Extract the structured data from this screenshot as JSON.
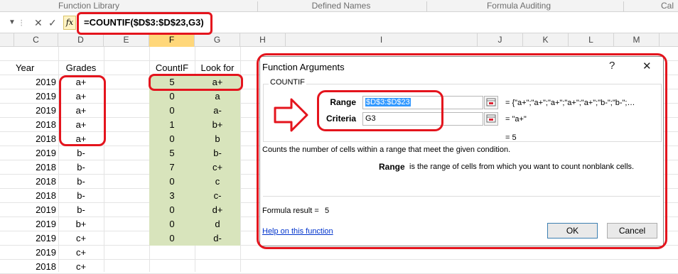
{
  "ribbon": {
    "groups": [
      "Function Library",
      "Defined Names",
      "Formula Auditing",
      "Cal"
    ]
  },
  "formula_bar": {
    "cancel_glyph": "✕",
    "enter_glyph": "✓",
    "fx_label": "fx",
    "formula": "=COUNTIF($D$3:$D$23,G3)"
  },
  "columns": [
    "C",
    "D",
    "E",
    "F",
    "G",
    "H",
    "I",
    "J",
    "K",
    "L",
    "M"
  ],
  "header_row": {
    "year": "Year",
    "grades": "Grades",
    "countif": "CountIF",
    "lookfor": "Look for"
  },
  "rows": [
    {
      "year": "2019",
      "grade": "a+",
      "count": "5",
      "look": "a+"
    },
    {
      "year": "2019",
      "grade": "a+",
      "count": "0",
      "look": "a"
    },
    {
      "year": "2019",
      "grade": "a+",
      "count": "0",
      "look": "a-"
    },
    {
      "year": "2018",
      "grade": "a+",
      "count": "1",
      "look": "b+"
    },
    {
      "year": "2018",
      "grade": "a+",
      "count": "0",
      "look": "b"
    },
    {
      "year": "2019",
      "grade": "b-",
      "count": "5",
      "look": "b-"
    },
    {
      "year": "2018",
      "grade": "b-",
      "count": "7",
      "look": "c+"
    },
    {
      "year": "2018",
      "grade": "b-",
      "count": "0",
      "look": "c"
    },
    {
      "year": "2018",
      "grade": "b-",
      "count": "3",
      "look": "c-"
    },
    {
      "year": "2019",
      "grade": "b-",
      "count": "0",
      "look": "d+"
    },
    {
      "year": "2019",
      "grade": "b+",
      "count": "0",
      "look": "d"
    },
    {
      "year": "2019",
      "grade": "c+",
      "count": "0",
      "look": "d-"
    },
    {
      "year": "2019",
      "grade": "c+",
      "count": "",
      "look": ""
    },
    {
      "year": "2018",
      "grade": "c+",
      "count": "",
      "look": ""
    }
  ],
  "dialog": {
    "title": "Function Arguments",
    "help_glyph": "?",
    "close_glyph": "✕",
    "function_name": "COUNTIF",
    "range_label": "Range",
    "range_value": "$D$3:$D$23",
    "range_result": "=  {\"a+\";\"a+\";\"a+\";\"a+\";\"a+\";\"b-\";\"b-\";…",
    "criteria_label": "Criteria",
    "criteria_value": "G3",
    "criteria_result": "=  \"a+\"",
    "total_result": "=   5",
    "description": "Counts the number of cells within a range that meet the given condition.",
    "arg_name": "Range",
    "arg_description": "is the range of cells from which you want to count nonblank cells.",
    "formula_result_label": "Formula result =",
    "formula_result_value": "5",
    "help_link": "Help on this function",
    "ok_label": "OK",
    "cancel_label": "Cancel"
  },
  "colors": {
    "annotation": "#e4141d",
    "countif_fill": "#d8e4bc",
    "selected_header": "#ffd77a"
  }
}
